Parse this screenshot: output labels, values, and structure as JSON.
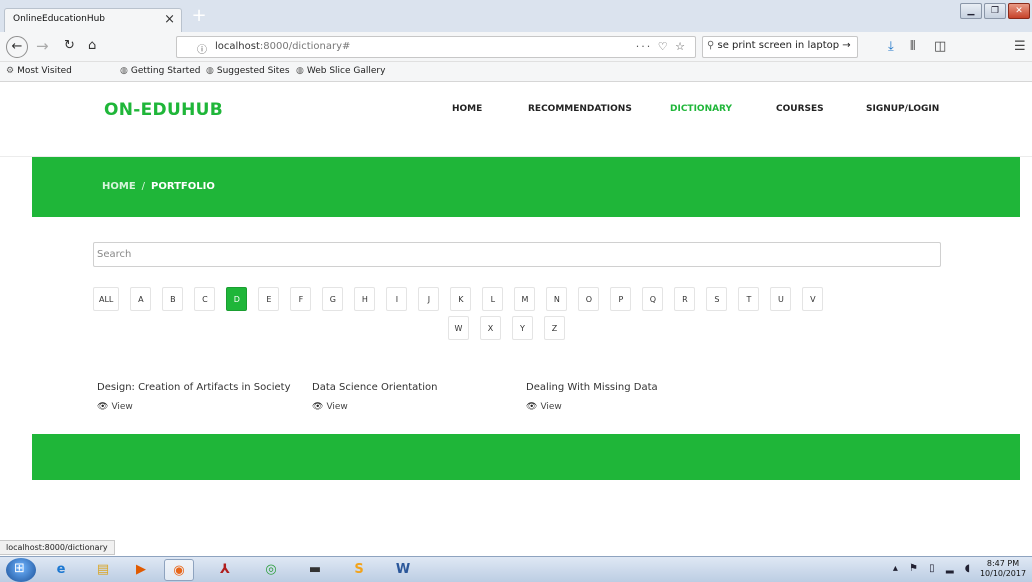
{
  "browser": {
    "tab_title": "OnlineEducationHub",
    "tab_close": "×",
    "new_tab": "+",
    "url_host": "localhost",
    "url_path": ":8000/dictionary#",
    "url_actions": "··· ♡ ☆",
    "search_value": "se print screen in laptop →",
    "bookmarks": [
      "Most Visited",
      "Getting Started",
      "Suggested Sites",
      "Web Slice Gallery"
    ],
    "status_url": "localhost:8000/dictionary"
  },
  "site": {
    "logo": "ON-EDUHUB",
    "menu": [
      "HOME",
      "RECOMMENDATIONS",
      "DICTIONARY",
      "COURSES",
      "SIGNUP/LOGIN"
    ],
    "active_menu": "DICTIONARY",
    "breadcrumb_home": "HOME",
    "breadcrumb_sep": "/",
    "breadcrumb_current": "PORTFOLIO",
    "accent_color": "#1fb639"
  },
  "dictionary": {
    "search_placeholder": "Search",
    "letters_row1": [
      "ALL",
      "A",
      "B",
      "C",
      "D",
      "E",
      "F",
      "G",
      "H",
      "I",
      "J",
      "K",
      "L",
      "M",
      "N",
      "O",
      "P",
      "Q",
      "R",
      "S",
      "T",
      "U",
      "V"
    ],
    "letters_row2": [
      "W",
      "X",
      "Y",
      "Z"
    ],
    "active_letter": "D",
    "results": [
      {
        "title": "Design: Creation of Artifacts in Society",
        "view": "View"
      },
      {
        "title": "Data Science Orientation",
        "view": "View"
      },
      {
        "title": "Dealing With Missing Data",
        "view": "View"
      }
    ]
  },
  "taskbar": {
    "time": "8:47 PM",
    "date": "10/10/2017"
  }
}
